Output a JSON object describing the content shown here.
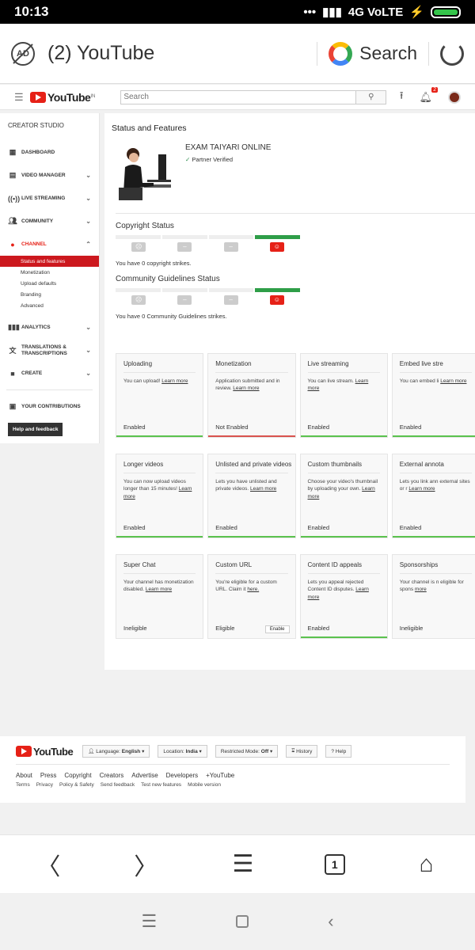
{
  "statusbar": {
    "time": "10:13",
    "signal": "4G VoLTE",
    "dots": "•••"
  },
  "browser": {
    "tab_title": "(2) YouTube",
    "search_label": "Search",
    "adblock_label": "AD"
  },
  "yt_header": {
    "logo_text": "YouTube",
    "country": "IN",
    "search_placeholder": "Search",
    "notification_count": "2"
  },
  "sidebar": {
    "title": "CREATOR STUDIO",
    "items": [
      {
        "label": "DASHBOARD",
        "icon": "dashboard-icon",
        "chevron": false
      },
      {
        "label": "VIDEO MANAGER",
        "icon": "video-manager-icon",
        "chevron": true
      },
      {
        "label": "LIVE STREAMING",
        "icon": "live-streaming-icon",
        "chevron": true
      },
      {
        "label": "COMMUNITY",
        "icon": "community-icon",
        "chevron": true
      },
      {
        "label": "CHANNEL",
        "icon": "channel-icon",
        "chevron": true
      }
    ],
    "channel_sub": [
      "Status and features",
      "Monetization",
      "Upload defaults",
      "Branding",
      "Advanced"
    ],
    "items2": [
      {
        "label": "ANALYTICS",
        "icon": "analytics-icon"
      },
      {
        "label": "TRANSLATIONS & TRANSCRIPTIONS",
        "icon": "translate-icon"
      },
      {
        "label": "CREATE",
        "icon": "create-icon"
      }
    ],
    "contributions": "YOUR CONTRIBUTIONS",
    "help": "Help and feedback"
  },
  "main": {
    "title": "Status and Features",
    "channel_name": "EXAM TAIYARI ONLINE",
    "verified": "Partner Verified",
    "copyright_title": "Copyright Status",
    "copyright_note": "You have 0 copyright strikes.",
    "community_title": "Community Guidelines Status",
    "community_note": "You have 0 Community Guidelines strikes.",
    "cards": [
      {
        "title": "Uploading",
        "desc": "You can upload!",
        "link": "Learn more",
        "status": "Enabled",
        "bar": "#5bc24e"
      },
      {
        "title": "Monetization",
        "desc": "Application submitted and in review.",
        "link": "Learn more",
        "status": "Not Enabled",
        "bar": "#d9534f"
      },
      {
        "title": "Live streaming",
        "desc": "You can live stream.",
        "link": "Learn more",
        "status": "Enabled",
        "bar": "#5bc24e"
      },
      {
        "title": "Embed live stre",
        "desc": "You can embed li",
        "link": "Learn more",
        "status": "Enabled",
        "bar": "#5bc24e"
      },
      {
        "title": "Longer videos",
        "desc": "You can now upload videos longer than 15 minutes!",
        "link": "Learn more",
        "status": "Enabled",
        "bar": "#5bc24e"
      },
      {
        "title": "Unlisted and private videos",
        "desc": "Lets you have unlisted and private videos.",
        "link": "Learn more",
        "status": "Enabled",
        "bar": "#5bc24e"
      },
      {
        "title": "Custom thumbnails",
        "desc": "Choose your video's thumbnail by uploading your own.",
        "link": "Learn more",
        "status": "Enabled",
        "bar": "#5bc24e"
      },
      {
        "title": "External annota",
        "desc": "Lets you link ann external sites or r",
        "link": "Learn more",
        "status": "Enabled",
        "bar": "#5bc24e"
      },
      {
        "title": "Super Chat",
        "desc": "Your channel has monetization disabled.",
        "link": "Learn more",
        "status": "Ineligible",
        "bar": ""
      },
      {
        "title": "Custom URL",
        "desc": "You're eligible for a custom URL. Claim it",
        "link": "here.",
        "status": "Eligible",
        "bar": "",
        "button": "Enable"
      },
      {
        "title": "Content ID appeals",
        "desc": "Lets you appeal rejected Content ID disputes.",
        "link": "Learn more",
        "status": "Enabled",
        "bar": "#5bc24e"
      },
      {
        "title": "Sponsorships",
        "desc": "Your channel is n eligible for spons",
        "link": "more",
        "status": "Ineligible",
        "bar": ""
      }
    ]
  },
  "footer": {
    "logo_text": "YouTube",
    "language_label": "Language:",
    "language_value": "English",
    "location_label": "Location:",
    "location_value": "India",
    "restricted_label": "Restricted Mode:",
    "restricted_value": "Off",
    "history": "History",
    "help": "Help",
    "links": [
      "About",
      "Press",
      "Copyright",
      "Creators",
      "Advertise",
      "Developers",
      "+YouTube"
    ],
    "links2": [
      "Terms",
      "Privacy",
      "Policy & Safety",
      "Send feedback",
      "Test new features",
      "Mobile version"
    ]
  },
  "browser_nav": {
    "tab_count": "1"
  }
}
